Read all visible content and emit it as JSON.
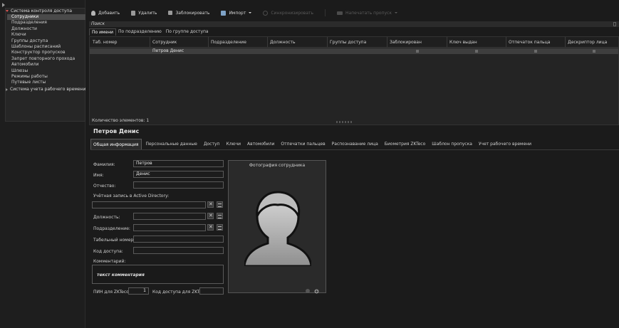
{
  "nav": {
    "groups": [
      {
        "label": "Система контроля доступа",
        "expanded": true
      },
      {
        "label": "Система учета рабочего времени",
        "expanded": false
      }
    ],
    "items": [
      {
        "label": "Сотрудники",
        "active": true
      },
      {
        "label": "Подразделения"
      },
      {
        "label": "Должности"
      },
      {
        "label": "Ключи"
      },
      {
        "label": "Группы доступа"
      },
      {
        "label": "Шаблоны расписаний"
      },
      {
        "label": "Конструктор пропусков"
      },
      {
        "label": "Запрет повторного прохода"
      },
      {
        "label": "Автомобили"
      },
      {
        "label": "Шлюзы"
      },
      {
        "label": "Режимы работы"
      },
      {
        "label": "Путевые листы"
      }
    ]
  },
  "toolbar": {
    "add": "Добавить",
    "delete": "Удалить",
    "block": "Заблокировать",
    "import": "Импорт",
    "sync": "Синхронизировать",
    "print_pass": "Напечатать пропуск"
  },
  "search": {
    "title": "Поиск",
    "tabs": [
      "По имени",
      "По подразделению",
      "По группе доступа"
    ]
  },
  "grid": {
    "columns": [
      "Таб. номер",
      "Сотрудник",
      "Подразделение",
      "Должность",
      "Группы доступа",
      "Заблокирован",
      "Ключ выдан",
      "Отпечаток пальца",
      "Дескриптор лица"
    ],
    "rows": [
      {
        "tab_number": "",
        "employee": "Петров Денис",
        "department": "",
        "position": "",
        "groups": ""
      }
    ],
    "count_label": "Количество элементов: 1"
  },
  "detail": {
    "title": "Петров Денис",
    "tabs": [
      "Общая информация",
      "Персональные данные",
      "Доступ",
      "Ключи",
      "Автомобили",
      "Отпечатки пальцев",
      "Распознавание лица",
      "Биометрия ZKTeco",
      "Шаблон пропуска",
      "Учет рабочего времени"
    ],
    "labels": {
      "lastname": "Фамилия:",
      "firstname": "Имя:",
      "middlename": "Отчество:",
      "ad_account": "Учётная запись в Active Directory:",
      "position": "Должность:",
      "department": "Подразделение:",
      "tab_number": "Табельный номер:",
      "access_code": "Код доступа:",
      "comment": "Комментарий:",
      "zk_pin": "ПИН для ZKTeco:",
      "zk_code": "Код доступа для ZKTeco:"
    },
    "values": {
      "lastname": "Петров",
      "firstname": "Денис",
      "middlename": "",
      "ad_account": "",
      "position": "",
      "department": "",
      "tab_number": "",
      "access_code": "",
      "comment": "текст комментария",
      "zk_pin": "1",
      "zk_code": ""
    },
    "photo_title": "Фотография сотрудника"
  },
  "colors": {
    "background": "#1b1b1b",
    "active_item": "#4a4a4a",
    "accent_red": "#d9534f"
  }
}
